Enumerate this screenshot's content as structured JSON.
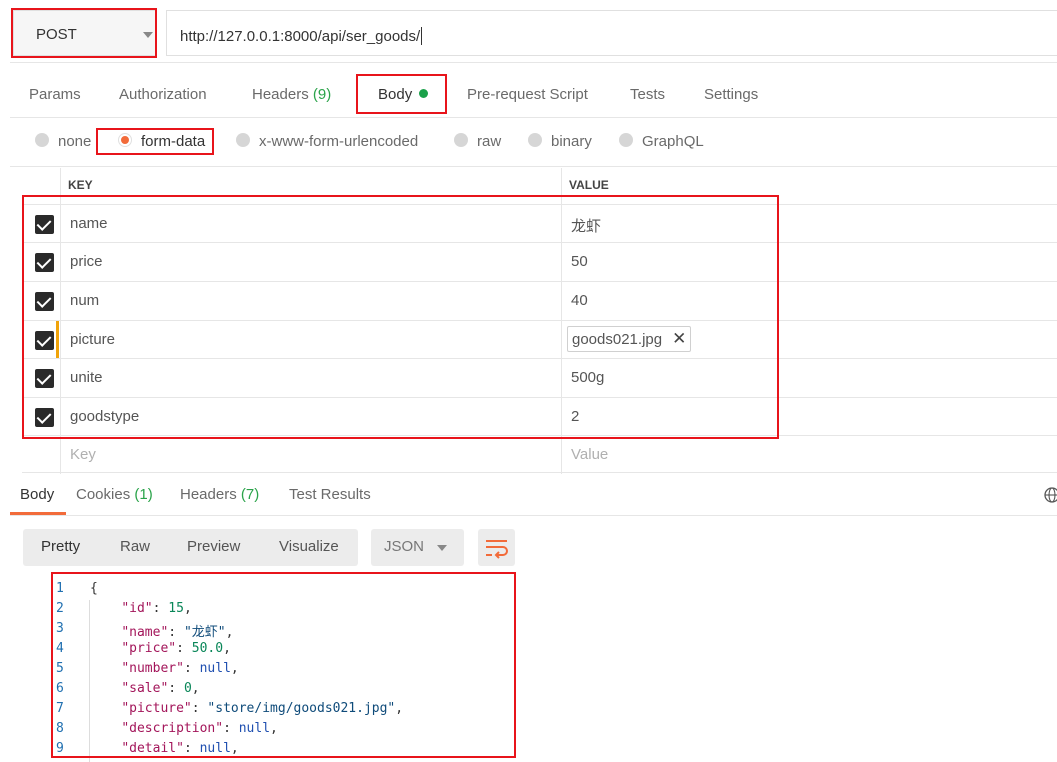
{
  "request": {
    "method": "POST",
    "url": "http://127.0.0.1:8000/api/ser_goods/"
  },
  "request_tabs": [
    {
      "label": "Params"
    },
    {
      "label": "Authorization"
    },
    {
      "label": "Headers",
      "count": "(9)"
    },
    {
      "label": "Body"
    },
    {
      "label": "Pre-request Script"
    },
    {
      "label": "Tests"
    },
    {
      "label": "Settings"
    }
  ],
  "body_types": [
    "none",
    "form-data",
    "x-www-form-urlencoded",
    "raw",
    "binary",
    "GraphQL"
  ],
  "selected_body_type": "form-data",
  "form_table": {
    "headers": {
      "key": "KEY",
      "value": "VALUE"
    },
    "rows": [
      {
        "key": "name",
        "value": "龙虾",
        "checked": true
      },
      {
        "key": "price",
        "value": "50",
        "checked": true
      },
      {
        "key": "num",
        "value": "40",
        "checked": true
      },
      {
        "key": "picture",
        "value": "goods021.jpg",
        "checked": true,
        "type": "file"
      },
      {
        "key": "unite",
        "value": "500g",
        "checked": true
      },
      {
        "key": "goodstype",
        "value": "2",
        "checked": true
      }
    ],
    "placeholder": {
      "key": "Key",
      "value": "Value"
    }
  },
  "response_tabs": [
    {
      "label": "Body"
    },
    {
      "label": "Cookies",
      "count": "(1)"
    },
    {
      "label": "Headers",
      "count": "(7)"
    },
    {
      "label": "Test Results"
    }
  ],
  "view_modes": [
    "Pretty",
    "Raw",
    "Preview",
    "Visualize"
  ],
  "language": "JSON",
  "code_lines": [
    {
      "n": "1",
      "text": "{"
    },
    {
      "n": "2",
      "key": "\"id\"",
      "val": "15",
      "vt": "n"
    },
    {
      "n": "3",
      "key": "\"name\"",
      "val": "\"龙虾\"",
      "vt": "s"
    },
    {
      "n": "4",
      "key": "\"price\"",
      "val": "50.0",
      "vt": "n"
    },
    {
      "n": "5",
      "key": "\"number\"",
      "val": "null",
      "vt": "nl"
    },
    {
      "n": "6",
      "key": "\"sale\"",
      "val": "0",
      "vt": "n"
    },
    {
      "n": "7",
      "key": "\"picture\"",
      "val": "\"store/img/goods021.jpg\"",
      "vt": "s"
    },
    {
      "n": "8",
      "key": "\"description\"",
      "val": "null",
      "vt": "nl"
    },
    {
      "n": "9",
      "key": "\"detail\"",
      "val": "null",
      "vt": "nl"
    }
  ]
}
